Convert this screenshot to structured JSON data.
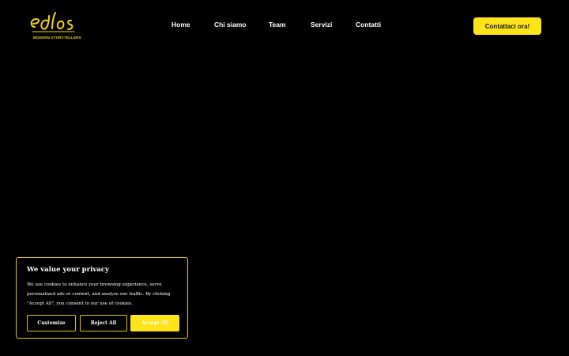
{
  "brand": {
    "logo_tagline": "MODERN STORYTELLERS",
    "accent_color": "#ffe41a",
    "background_color": "#000000"
  },
  "nav": {
    "items": [
      {
        "label": "Home"
      },
      {
        "label": "Chi siamo"
      },
      {
        "label": "Team"
      },
      {
        "label": "Servizi"
      },
      {
        "label": "Contatti"
      }
    ],
    "cta_label": "Contattaci ora!"
  },
  "cookie_banner": {
    "title": "We value your privacy",
    "body": "We use cookies to enhance your browsing experience, serve personalized ads or content, and analyze our traffic. By clicking \"Accept All\", you consent to our use of cookies.",
    "buttons": {
      "customize": "Customize",
      "reject": "Reject All",
      "accept": "Accept All"
    }
  }
}
